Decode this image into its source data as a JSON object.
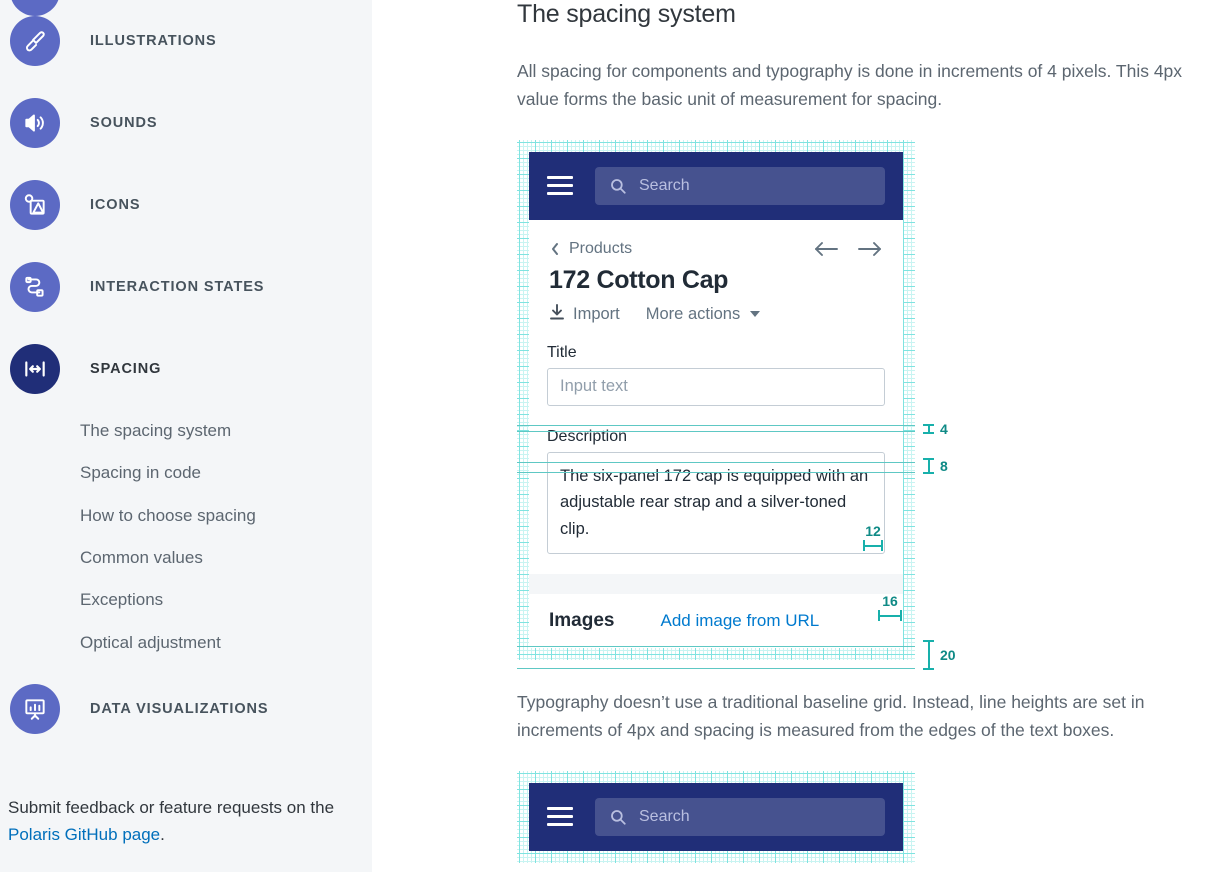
{
  "sidebar": {
    "items": [
      {
        "label": "ILLUSTRATIONS",
        "icon": "paintbrush-icon",
        "active": false
      },
      {
        "label": "SOUNDS",
        "icon": "speaker-icon",
        "active": false
      },
      {
        "label": "ICONS",
        "icon": "image-icon",
        "active": false
      },
      {
        "label": "INTERACTION STATES",
        "icon": "interaction-states-icon",
        "active": false
      },
      {
        "label": "SPACING",
        "icon": "spacing-icon",
        "active": true
      },
      {
        "label": "DATA VISUALIZATIONS",
        "icon": "chart-easel-icon",
        "active": false
      }
    ],
    "spacing_subitems": [
      "The spacing system",
      "Spacing in code",
      "How to choose spacing",
      "Common values",
      "Exceptions",
      "Optical adjustment"
    ],
    "footer": {
      "text_before": "Submit feedback or feature requests on the ",
      "link": "Polaris GitHub page",
      "text_after": "."
    }
  },
  "main": {
    "heading": "The spacing system",
    "paragraph1": "All spacing for components and typography is done in increments of 4 pixels. This 4px value forms the basic unit of measurement for spacing.",
    "paragraph2": "Typography doesn’t use a traditional baseline grid. Instead, line heights are set in increments of 4px and spacing is measured from the edges of the text boxes."
  },
  "mockup": {
    "search_placeholder": "Search",
    "breadcrumb": "Products",
    "title": "172 Cotton Cap",
    "actions": {
      "import": "Import",
      "more": "More actions"
    },
    "fields": {
      "title_label": "Title",
      "title_placeholder": "Input text",
      "description_label": "Description",
      "description_value": "The six-panel 172 cap is equipped with an adjustable rear strap and a silver-toned clip."
    },
    "images": {
      "title": "Images",
      "link": "Add image from URL"
    }
  },
  "annotations": {
    "a4": "4",
    "a8": "8",
    "a12": "12",
    "a16": "16",
    "a20": "20"
  },
  "colors": {
    "nav_icon": "#5c6ac4",
    "nav_icon_active": "#202e78",
    "topbar": "#202e78",
    "grid_line": "#7fe3e0",
    "annotation": "#18b0ab",
    "link": "#006fbb"
  }
}
